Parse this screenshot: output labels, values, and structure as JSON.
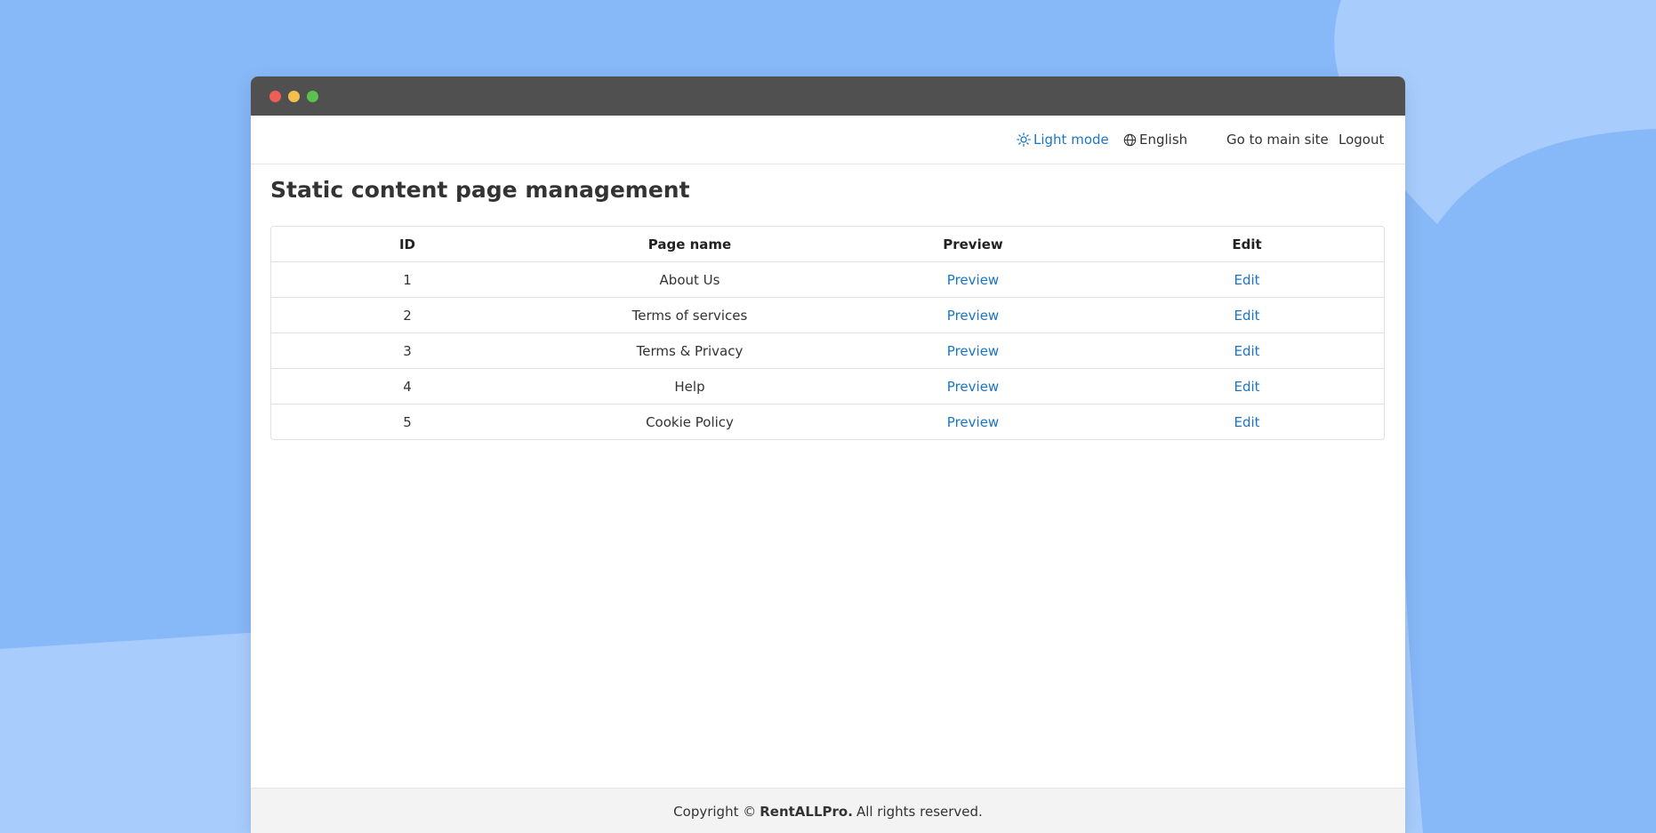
{
  "nav": {
    "theme_label": "Light mode",
    "language_label": "English",
    "main_site_label": "Go to main site",
    "logout_label": "Logout"
  },
  "page": {
    "title": "Static content page management"
  },
  "table": {
    "headers": [
      "ID",
      "Page name",
      "Preview",
      "Edit"
    ],
    "rows": [
      {
        "id": "1",
        "name": "About Us",
        "preview": "Preview",
        "edit": "Edit"
      },
      {
        "id": "2",
        "name": "Terms of services",
        "preview": "Preview",
        "edit": "Edit"
      },
      {
        "id": "3",
        "name": "Terms & Privacy",
        "preview": "Preview",
        "edit": "Edit"
      },
      {
        "id": "4",
        "name": "Help",
        "preview": "Preview",
        "edit": "Edit"
      },
      {
        "id": "5",
        "name": "Cookie Policy",
        "preview": "Preview",
        "edit": "Edit"
      }
    ]
  },
  "footer": {
    "prefix": "Copyright ©",
    "brand": "RentALLPro.",
    "suffix": "All rights reserved."
  },
  "colors": {
    "accent_link": "#1a75c9",
    "background": "#87b8f8",
    "titlebar": "#505050"
  }
}
